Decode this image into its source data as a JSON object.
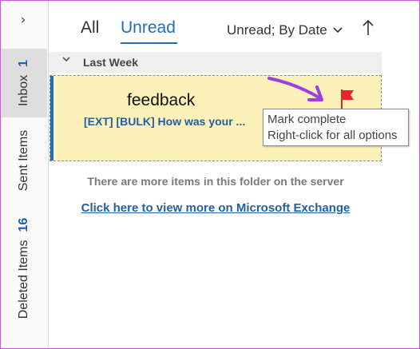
{
  "rail": {
    "inbox_label": "Inbox",
    "inbox_count": "1",
    "sent_label": "Sent Items",
    "deleted_label": "Deleted Items",
    "deleted_count": "16"
  },
  "header": {
    "tab_all": "All",
    "tab_unread": "Unread",
    "sort_label": "Unread; By Date",
    "sort_direction_icon": "arrow-up-icon"
  },
  "group": {
    "label": "Last Week"
  },
  "message": {
    "sender": "feedback",
    "subject": "[EXT] [BULK] How was your ...",
    "flag_color": "#e8232a"
  },
  "tooltip": {
    "line1": "Mark complete",
    "line2": "Right-click for all options"
  },
  "footer": {
    "note": "There are more items in this folder on the server",
    "link": "Click here to view more on Microsoft Exchange"
  },
  "colors": {
    "accent": "#1f6fb8",
    "selection_bg": "#fcf1b8",
    "annotation_arrow": "#9b3fe0"
  }
}
